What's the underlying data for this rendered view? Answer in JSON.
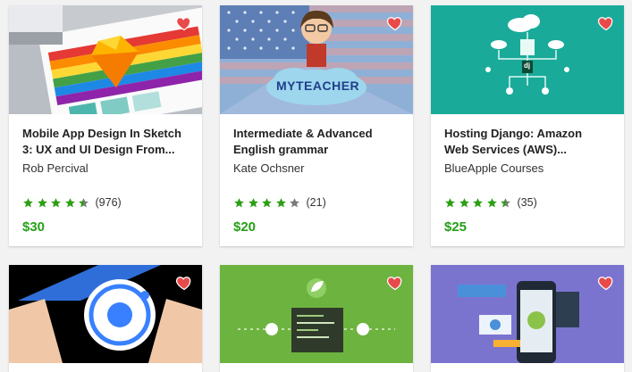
{
  "courses": [
    {
      "title_line1": "Mobile App Design In Sketch",
      "title_line2": "3: UX and UI Design From...",
      "author": "Rob Percival",
      "rating_value": 4.5,
      "reviews": "(976)",
      "price": "$30",
      "thumb_text": ""
    },
    {
      "title_line1": "Intermediate & Advanced",
      "title_line2": "English grammar",
      "author": "Kate Ochsner",
      "rating_value": 4,
      "reviews": "(21)",
      "price": "$20",
      "thumb_text": "MYTEACHER"
    },
    {
      "title_line1": "Hosting Django: Amazon",
      "title_line2": "Web Services (AWS)...",
      "author": "BlueApple Courses",
      "rating_value": 4.5,
      "reviews": "(35)",
      "price": "$25",
      "thumb_text": "dj"
    }
  ],
  "colors": {
    "heart": "#e84a4a",
    "star": "#2d9f15",
    "price": "#26a017"
  },
  "icons": {
    "wishlist": "heart-icon",
    "rating": "star-icon"
  }
}
